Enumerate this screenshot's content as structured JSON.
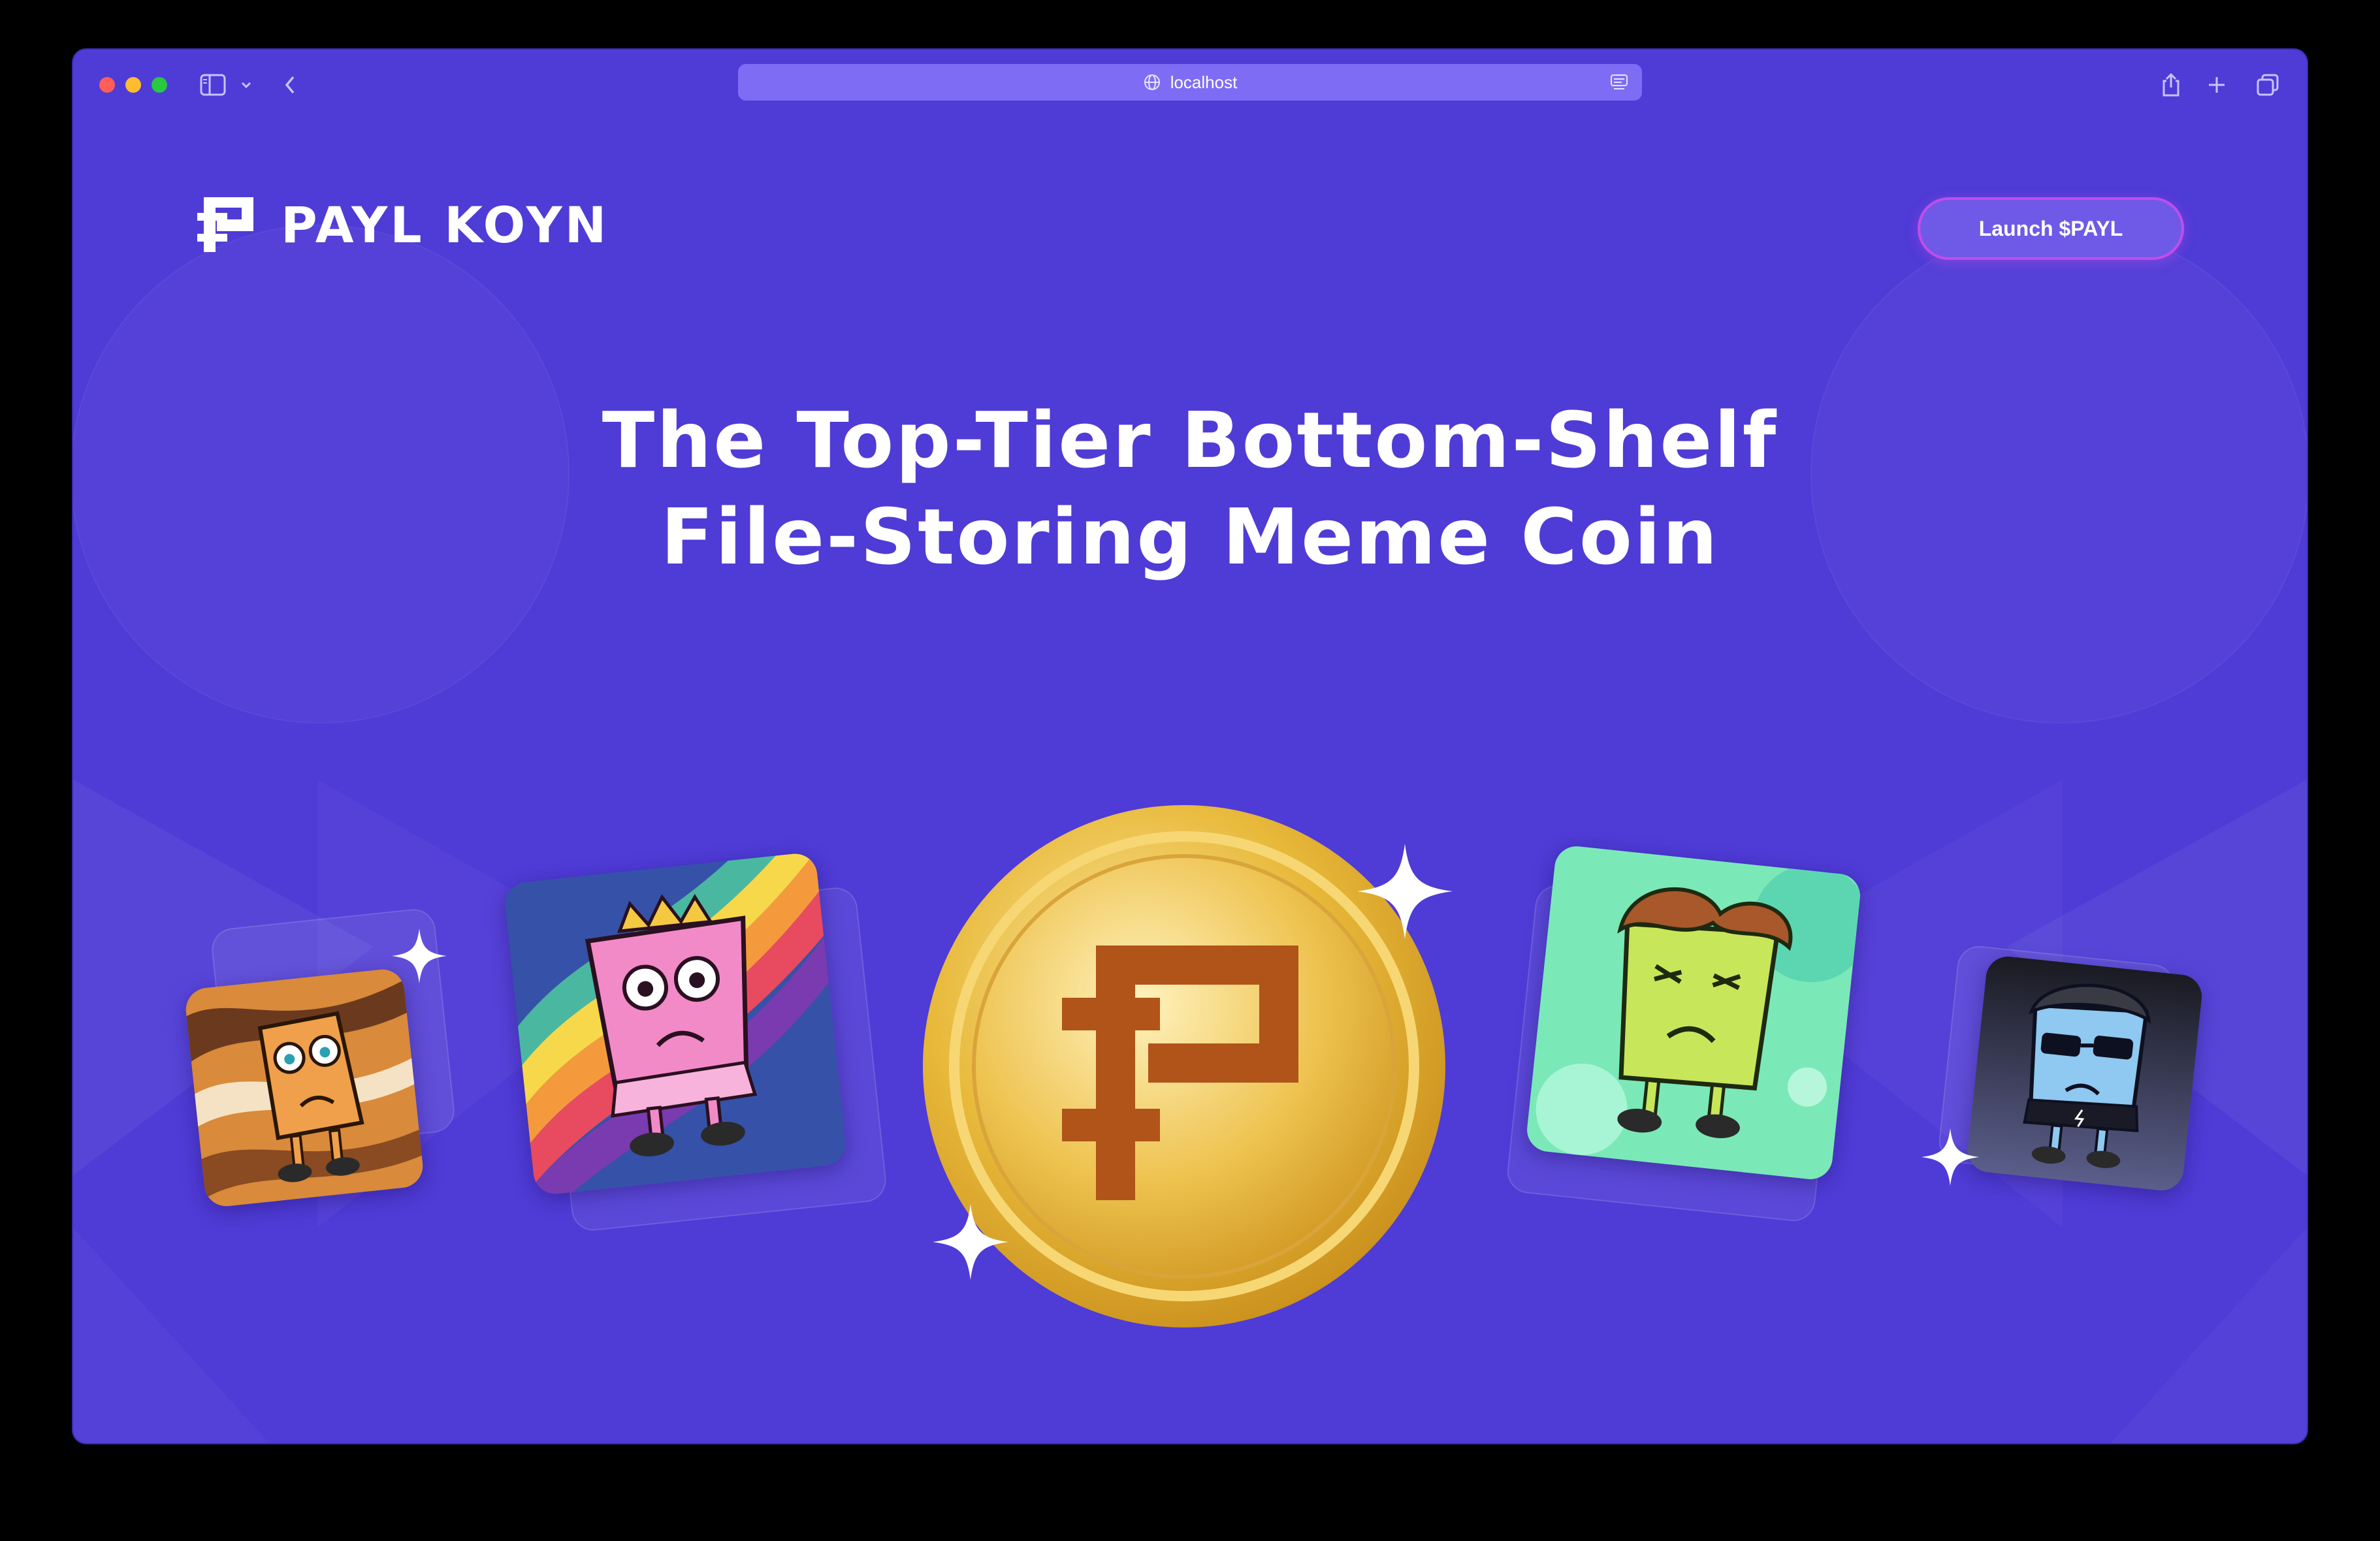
{
  "browser": {
    "url": "localhost",
    "colors": {
      "frame": "#4f3bd6",
      "address_bar": "#7f6cf4"
    }
  },
  "header": {
    "logo_text": "PAYL KOYN",
    "launch_button": "Launch $PAYL"
  },
  "hero": {
    "title_line1": "The Top-Tier Bottom-Shelf",
    "title_line2": "File-Storing Meme Coin"
  },
  "theme": {
    "page_bg": "#4f3bd6",
    "accent_border": "#c14de9",
    "button_bg": "#6f5ae8",
    "coin_gold": "#e8b93a",
    "coin_mark": "#b0541a"
  },
  "cards": [
    {
      "name": "orange-swirl-character",
      "icon": "orange-file-character"
    },
    {
      "name": "pink-princess-character",
      "icon": "pink-file-character"
    },
    {
      "name": "green-thinking-character",
      "icon": "green-file-character"
    },
    {
      "name": "cool-sunglasses-character",
      "icon": "blue-file-character"
    }
  ]
}
